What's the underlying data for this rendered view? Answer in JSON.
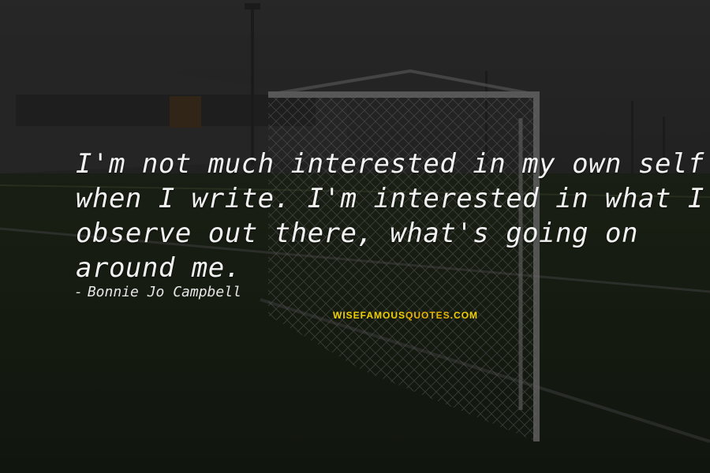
{
  "quote": {
    "lines": [
      "I'm not much interested in my own self",
      "when I write. I'm interested in what I",
      "observe out there, what's going on",
      "around me."
    ],
    "author_dash": "-",
    "author": "Bonnie Jo Campbell"
  },
  "watermark": {
    "part1": "WISEFAMOUS",
    "part2": "QUOTES",
    "part3": ".COM",
    "color_main": "#f0d000",
    "color_accent": "#e8b400"
  },
  "colors": {
    "text": "#f2f2f2",
    "overlay": "rgba(0,0,0,0.5)"
  }
}
